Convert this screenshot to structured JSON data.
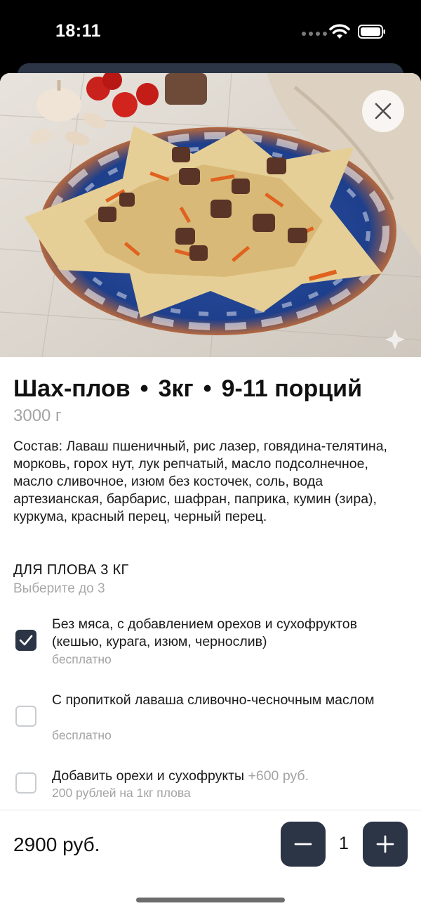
{
  "status_bar": {
    "time": "18:11"
  },
  "product": {
    "name": "Шах-плов",
    "size": "3кг",
    "portions": "9-11 порций",
    "weight": "3000 г",
    "composition": "Состав: Лаваш пшеничный, рис лазер, говядина-телятина, морковь, горох нут, лук репчатый, масло подсолнечное, масло сливочное, изюм без косточек, соль, вода артезианская, барбарис, шафран, паприка, кумин (зира), куркума, красный перец, черный перец."
  },
  "modifiers": {
    "title": "ДЛЯ ПЛОВА 3 КГ",
    "subtitle": "Выберите до 3",
    "options": [
      {
        "label": " Без мяса, с добавлением орехов и сухофруктов (кешью, курага, изюм, чернослив)",
        "price": "",
        "sub": "бесплатно",
        "checked": true
      },
      {
        "label": " С пропиткой лаваша сливочно-чесночным маслом",
        "price": "",
        "sub": "бесплатно",
        "checked": false
      },
      {
        "label": "Добавить орехи и сухофрукты ",
        "price": "+600 руб.",
        "sub": "200 рублей на 1кг плова",
        "checked": false
      }
    ]
  },
  "cart": {
    "total": "2900 руб.",
    "quantity": "1"
  },
  "colors": {
    "accent": "#2b3545",
    "muted": "#a3a3a3"
  },
  "icons": {
    "close": "close-icon",
    "minus": "minus-icon",
    "plus": "plus-icon",
    "check": "check-icon"
  }
}
